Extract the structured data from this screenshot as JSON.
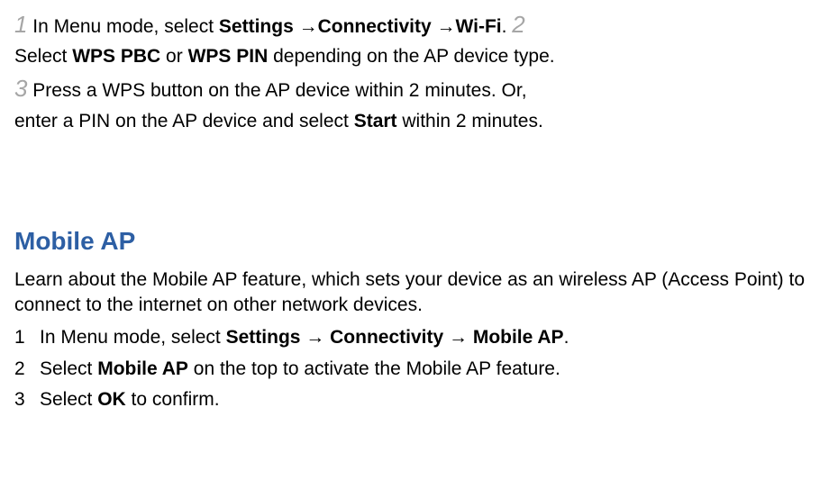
{
  "intro": {
    "step1_num": "1",
    "step1_a": " In Menu mode, select ",
    "step1_b1": "Settings",
    "step1_arrow": " →",
    "step1_b2": "Connectivity",
    "step1_b3": "Wi-Fi",
    "step1_dot": ". ",
    "step2_num": "2",
    "step2_a": "Select ",
    "step2_b1": "WPS PBC",
    "step2_or": " or ",
    "step2_b2": "WPS PIN",
    "step2_c": " depending on the AP device type.",
    "step3_num": "3",
    "step3_a": " Press a WPS button on the AP device within 2 minutes. Or,",
    "step3_line2a": "enter a PIN on the AP device and select ",
    "step3_b": "Start",
    "step3_line2b": " within 2 minutes."
  },
  "section": {
    "title": "Mobile AP",
    "desc": "Learn about the Mobile AP feature, which sets your device as an wireless AP (Access Point) to connect to the internet on other network devices.",
    "steps": {
      "s1_a": "In Menu mode, select ",
      "s1_b1": "Settings",
      "s1_arr": " → ",
      "s1_b2": "Connectivity",
      "s1_b3": "Mobile AP",
      "s1_dot": ".",
      "s2_a": "Select ",
      "s2_b": "Mobile AP",
      "s2_c": " on the top to activate the Mobile AP feature.",
      "s3_a": "Select ",
      "s3_b": "OK",
      "s3_c": " to confirm."
    }
  }
}
